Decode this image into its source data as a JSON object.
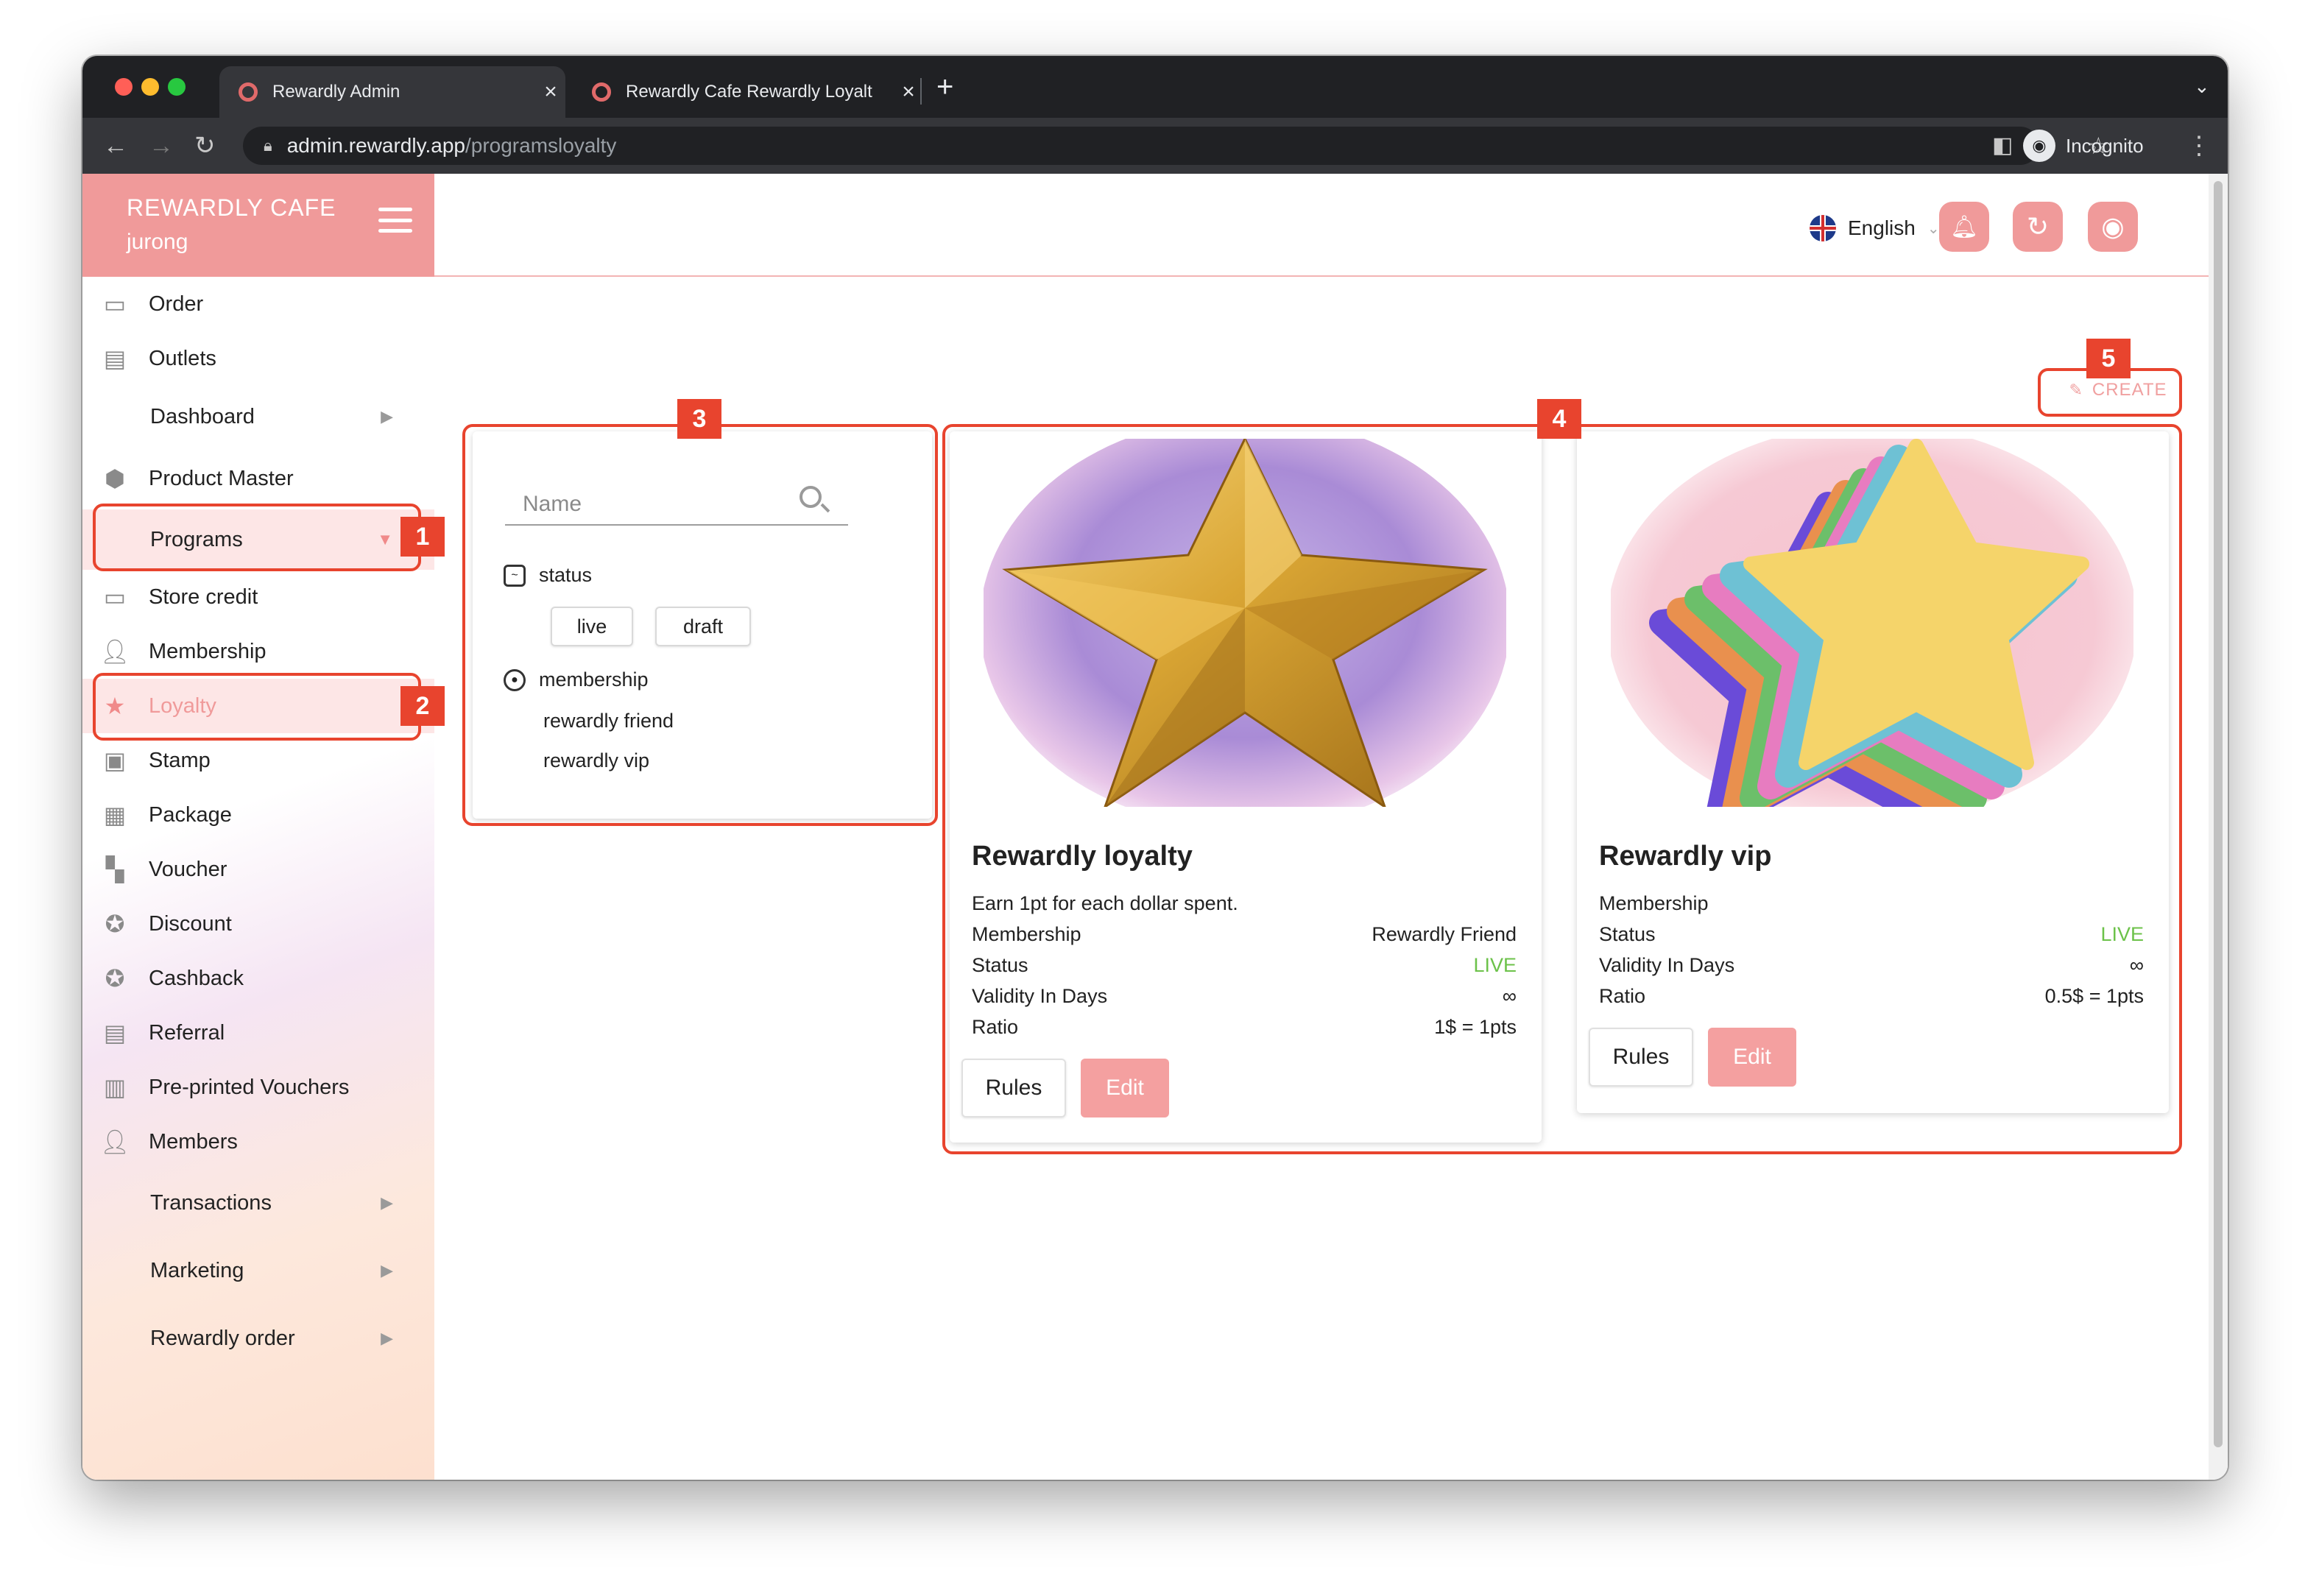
{
  "browser": {
    "tabs": [
      {
        "title": "Rewardly Admin"
      },
      {
        "title": "Rewardly Cafe Rewardly Loyalt"
      }
    ],
    "url_host": "admin.rewardly.app",
    "url_path": "/programsloyalty",
    "profile": "Incognito"
  },
  "sidebar": {
    "brand_name": "REWARDLY CAFE",
    "brand_sub": "jurong",
    "items": [
      {
        "label": "Order",
        "icon": "credit-card-icon"
      },
      {
        "label": "Outlets",
        "icon": "store-icon"
      },
      {
        "label": "Dashboard",
        "icon": ""
      },
      {
        "label": "Product Master",
        "icon": "cube-icon"
      },
      {
        "label": "Programs",
        "icon": ""
      },
      {
        "label": "Store credit",
        "icon": "credit-card-icon"
      },
      {
        "label": "Membership",
        "icon": "user-card-icon"
      },
      {
        "label": "Loyalty",
        "icon": "star-icon"
      },
      {
        "label": "Stamp",
        "icon": "stamp-icon"
      },
      {
        "label": "Package",
        "icon": "package-icon"
      },
      {
        "label": "Voucher",
        "icon": "voucher-icon"
      },
      {
        "label": "Discount",
        "icon": "discount-icon"
      },
      {
        "label": "Cashback",
        "icon": "cashback-icon"
      },
      {
        "label": "Referral",
        "icon": "referral-icon"
      },
      {
        "label": "Pre-printed Vouchers",
        "icon": "barcode-icon"
      },
      {
        "label": "Members",
        "icon": "add-user-icon"
      },
      {
        "label": "Transactions",
        "icon": ""
      },
      {
        "label": "Marketing",
        "icon": ""
      },
      {
        "label": "Rewardly order",
        "icon": ""
      }
    ]
  },
  "header": {
    "language": "English"
  },
  "toolbar": {
    "create_label": "CREATE"
  },
  "filter": {
    "search_placeholder": "Name",
    "status_label": "status",
    "status_options": [
      "live",
      "draft"
    ],
    "membership_label": "membership",
    "membership_options": [
      "rewardly friend",
      "rewardly vip"
    ]
  },
  "cards": [
    {
      "title": "Rewardly loyalty",
      "description": "Earn 1pt for each dollar spent.",
      "rows": [
        {
          "label": "Membership",
          "value": "Rewardly Friend"
        },
        {
          "label": "Status",
          "value": "LIVE"
        },
        {
          "label": "Validity In Days",
          "value": "∞"
        },
        {
          "label": "Ratio",
          "value": "1$ = 1pts"
        }
      ],
      "rules_label": "Rules",
      "edit_label": "Edit"
    },
    {
      "title": "Rewardly vip",
      "description": "",
      "rows": [
        {
          "label": "Membership",
          "value": ""
        },
        {
          "label": "Status",
          "value": "LIVE"
        },
        {
          "label": "Validity In Days",
          "value": "∞"
        },
        {
          "label": "Ratio",
          "value": "0.5$ = 1pts"
        }
      ],
      "rules_label": "Rules",
      "edit_label": "Edit"
    }
  ],
  "annotations": [
    "1",
    "2",
    "3",
    "4",
    "5"
  ],
  "colors": {
    "brand": "#f09a9a",
    "live": "#6cc24a",
    "annotation": "#e8442e"
  }
}
